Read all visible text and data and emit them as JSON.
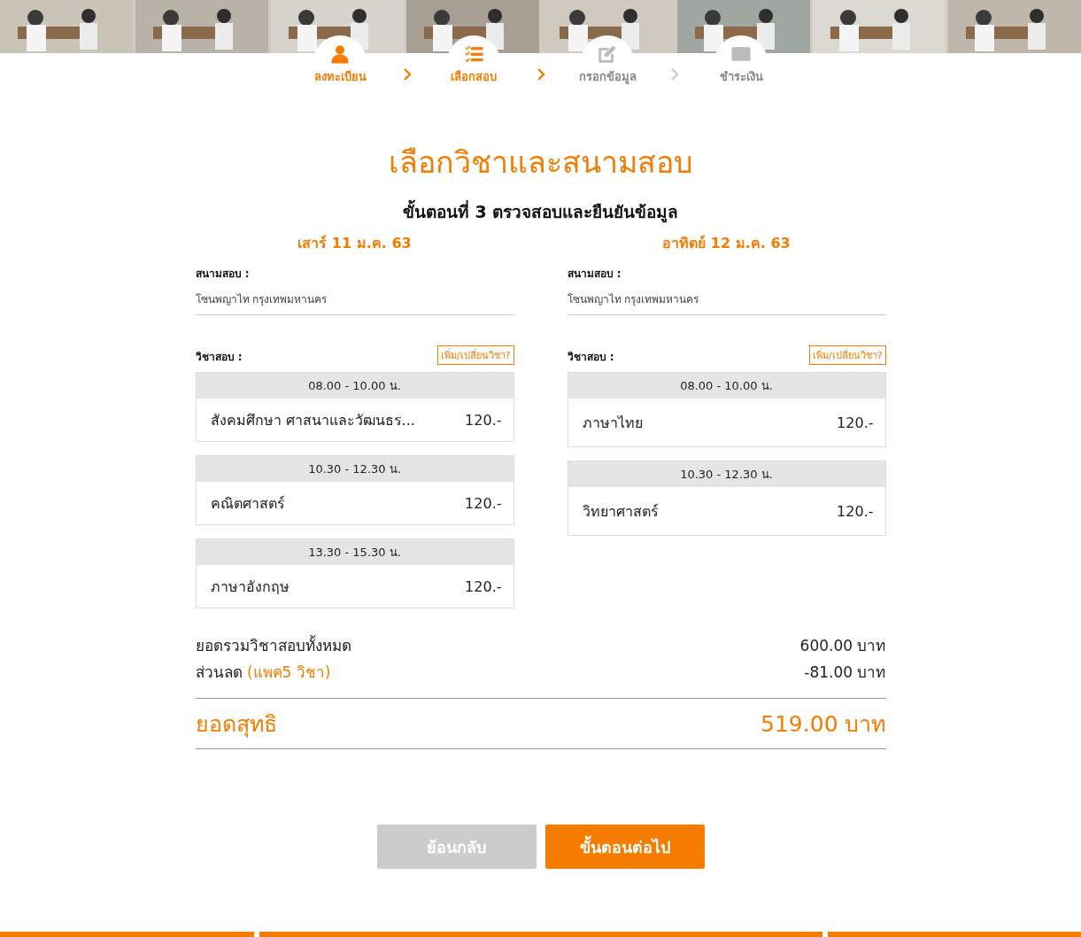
{
  "steps": [
    {
      "label": "ลงทะเบียน",
      "kind": "user",
      "active": true
    },
    {
      "label": "เลือกสอบ",
      "kind": "list",
      "active": true
    },
    {
      "label": "กรอกข้อมูล",
      "kind": "edit",
      "active": false
    },
    {
      "label": "ชำระเงิน",
      "kind": "card",
      "active": false
    }
  ],
  "title": "เลือกวิชาและสนามสอบ",
  "subtitle": "ขั้นตอนที่ 3 ตรวจสอบและยืนยันข้อมูล",
  "days": [
    {
      "date": "เสาร์ 11 ม.ค. 63",
      "venue_label": "สนามสอบ :",
      "venue": "โซนพญาไท กรุงเทพมหานคร",
      "subjects_label": "วิชาสอบ :",
      "change_link": "เพิ่ม/เปลี่ยนวิชา?",
      "sessions": [
        {
          "time": "08.00 - 10.00 น.",
          "subject": "สังคมศึกษา ศาสนาและวัฒนธร...",
          "price": "120.-"
        },
        {
          "time": "10.30 - 12.30 น.",
          "subject": "คณิตศาสตร์",
          "price": "120.-"
        },
        {
          "time": "13.30 - 15.30 น.",
          "subject": "ภาษาอังกฤษ",
          "price": "120.-"
        }
      ]
    },
    {
      "date": "อาทิตย์ 12 ม.ค. 63",
      "venue_label": "สนามสอบ :",
      "venue": "โซนพญาไท กรุงเทพมหานคร",
      "subjects_label": "วิชาสอบ :",
      "change_link": "เพิ่ม/เปลี่ยนวิชา?",
      "sessions": [
        {
          "time": "08.00 - 10.00 น.",
          "subject": "ภาษาไทย",
          "price": "120.-"
        },
        {
          "time": "10.30 - 12.30 น.",
          "subject": "วิทยาศาสตร์",
          "price": "120.-"
        }
      ]
    }
  ],
  "summary": {
    "total_label": "ยอดรวมวิชาสอบทั้งหมด",
    "total": "600.00 บาท",
    "discount_label": "ส่วนลด",
    "discount_note": "(แพค5 วิชา)",
    "discount": "-81.00 บาท",
    "net_label": "ยอดสุทธิ",
    "net": "519.00 บาท"
  },
  "buttons": {
    "back": "ย้อนกลับ",
    "next": "ขั้นตอนต่อไป"
  }
}
